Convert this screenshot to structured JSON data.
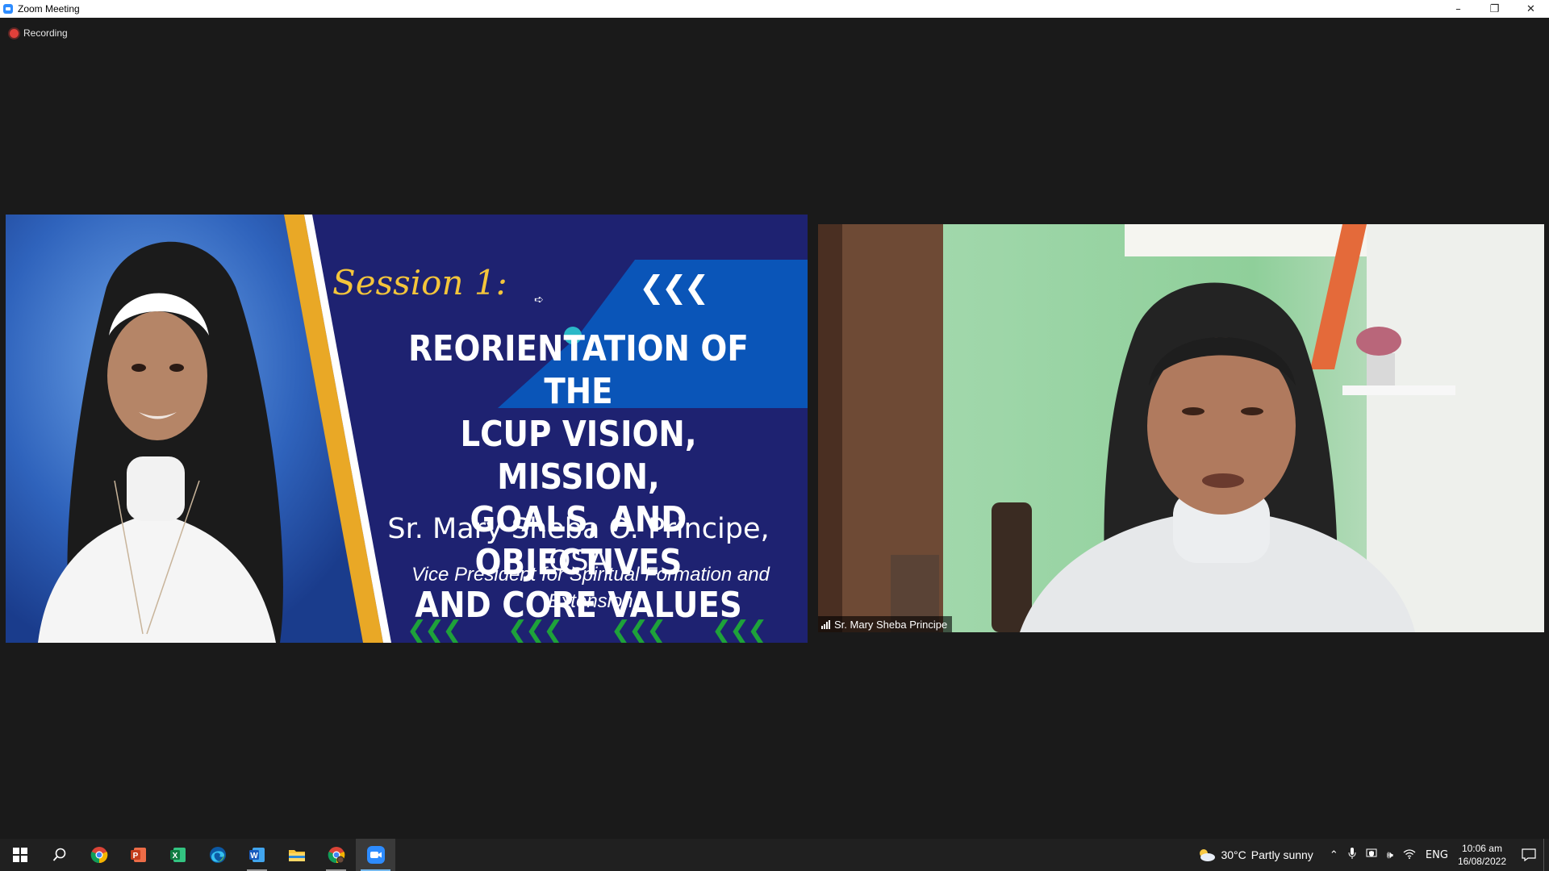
{
  "window": {
    "title": "Zoom Meeting",
    "controls": {
      "minimize": "–",
      "restore": "❐",
      "close": "✕"
    }
  },
  "recording": {
    "label": "Recording",
    "color": "#e0403a"
  },
  "slide": {
    "session": "Session 1:",
    "title_lines": [
      "REORIENTATION OF THE",
      "LCUP VISION, MISSION,",
      "GOALS, AND OBJECTIVES",
      "AND CORE VALUES"
    ],
    "speaker": "Sr. Mary Sheba O. Principe, OSA",
    "role": "Vice President for Spiritual Formation and Extension",
    "chevrons_top": "❮❮❮",
    "chevrons_bottom": "❮❮❮",
    "colors": {
      "background": "#1e2271",
      "accent_blue": "#0a55b8",
      "gold": "#e9a826",
      "session_text": "#f4c53b",
      "chevron_green": "#1ea23a"
    }
  },
  "video": {
    "participant_name": "Sr. Mary Sheba Principe",
    "signal_icon": "signal-bars-icon"
  },
  "taskbar": {
    "apps": [
      {
        "name": "start-icon",
        "label": "Start"
      },
      {
        "name": "search-icon",
        "label": "Search"
      },
      {
        "name": "chrome-icon",
        "label": "Google Chrome"
      },
      {
        "name": "powerpoint-icon",
        "label": "PowerPoint"
      },
      {
        "name": "excel-icon",
        "label": "Excel"
      },
      {
        "name": "edge-icon",
        "label": "Microsoft Edge"
      },
      {
        "name": "word-icon",
        "label": "Word"
      },
      {
        "name": "file-explorer-icon",
        "label": "File Explorer"
      },
      {
        "name": "chrome-profile-icon",
        "label": "Google Chrome"
      },
      {
        "name": "zoom-icon",
        "label": "Zoom"
      }
    ],
    "weather": {
      "temp": "30°C",
      "condition": "Partly sunny",
      "icon": "partly-sunny-icon"
    },
    "tray": {
      "language": "ENG",
      "chevron": "^"
    },
    "clock": {
      "time": "10:06 am",
      "date": "16/08/2022"
    }
  }
}
